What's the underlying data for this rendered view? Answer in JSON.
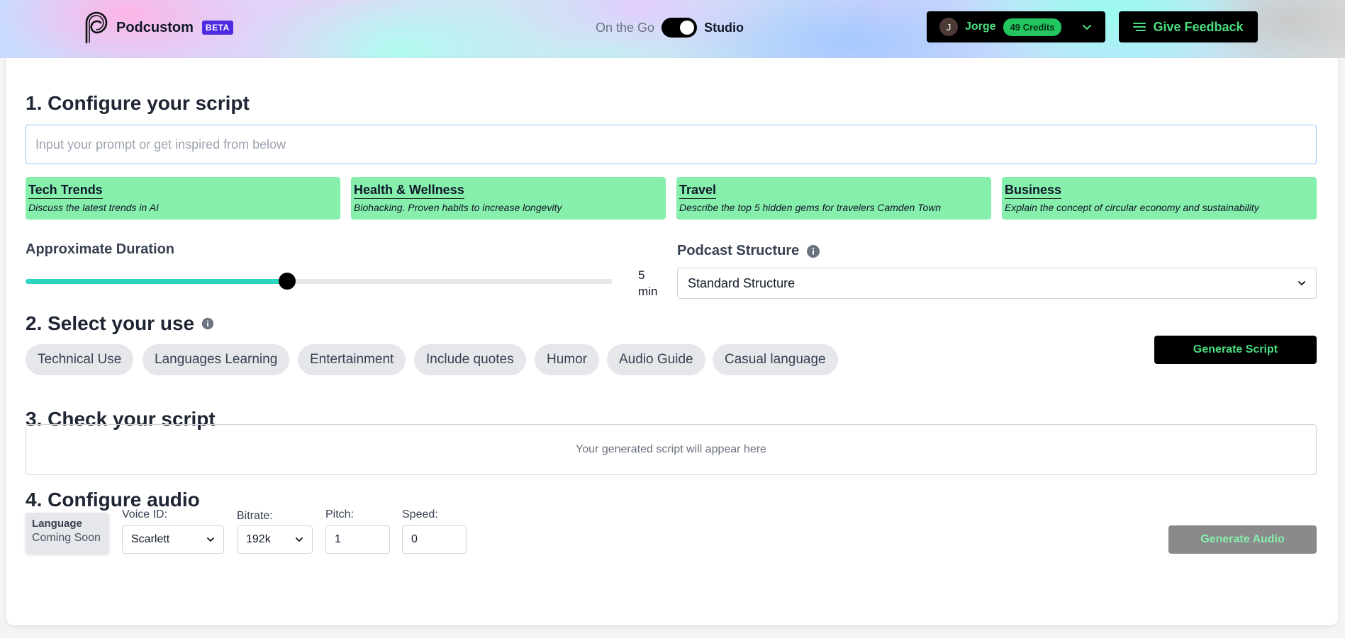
{
  "brand": {
    "name": "Podcustom",
    "badge": "BETA"
  },
  "mode": {
    "off_label": "On the Go",
    "on_label": "Studio",
    "active": "Studio"
  },
  "user": {
    "initial": "J",
    "name": "Jorge",
    "credits": "49 Credits"
  },
  "feedback": {
    "label": "Give Feedback"
  },
  "section1": {
    "title": "1. Configure your script",
    "prompt_placeholder": "Input your prompt or get inspired from below",
    "prompt_value": "",
    "topics": [
      {
        "title": "Tech Trends",
        "description": "Discuss the latest trends in AI"
      },
      {
        "title": "Health & Wellness",
        "description": "Biohacking. Proven habits to increase longevity"
      },
      {
        "title": "Travel",
        "description": "Describe the top 5 hidden gems for travelers Camden Town"
      },
      {
        "title": "Business",
        "description": "Explain the concept of circular economy and sustainability"
      }
    ],
    "duration": {
      "label": "Approximate Duration",
      "value": "5",
      "unit": "min",
      "slider_fraction": 0.446
    },
    "structure": {
      "label": "Podcast Structure",
      "selected": "Standard Structure"
    }
  },
  "section2": {
    "title": "2. Select your use",
    "uses": [
      "Technical Use",
      "Languages Learning",
      "Entertainment",
      "Include quotes",
      "Humor",
      "Audio Guide",
      "Casual language"
    ],
    "generate_label": "Generate Script"
  },
  "section3": {
    "title": "3. Check your script",
    "placeholder": "Your generated script will appear here"
  },
  "section4": {
    "title": "4. Configure audio",
    "language": {
      "title": "Language",
      "status": "Coming Soon"
    },
    "voice": {
      "label": "Voice ID:",
      "value": "Scarlett"
    },
    "bitrate": {
      "label": "Bitrate:",
      "value": "192k"
    },
    "pitch": {
      "label": "Pitch:",
      "value": "1"
    },
    "speed": {
      "label": "Speed:",
      "value": "0"
    },
    "generate_label": "Generate Audio"
  },
  "colors": {
    "accent_green": "#4ade80",
    "topic_card": "#86efac",
    "slider_fill": "#2dd4bf",
    "beta_badge": "#4f2be0"
  }
}
